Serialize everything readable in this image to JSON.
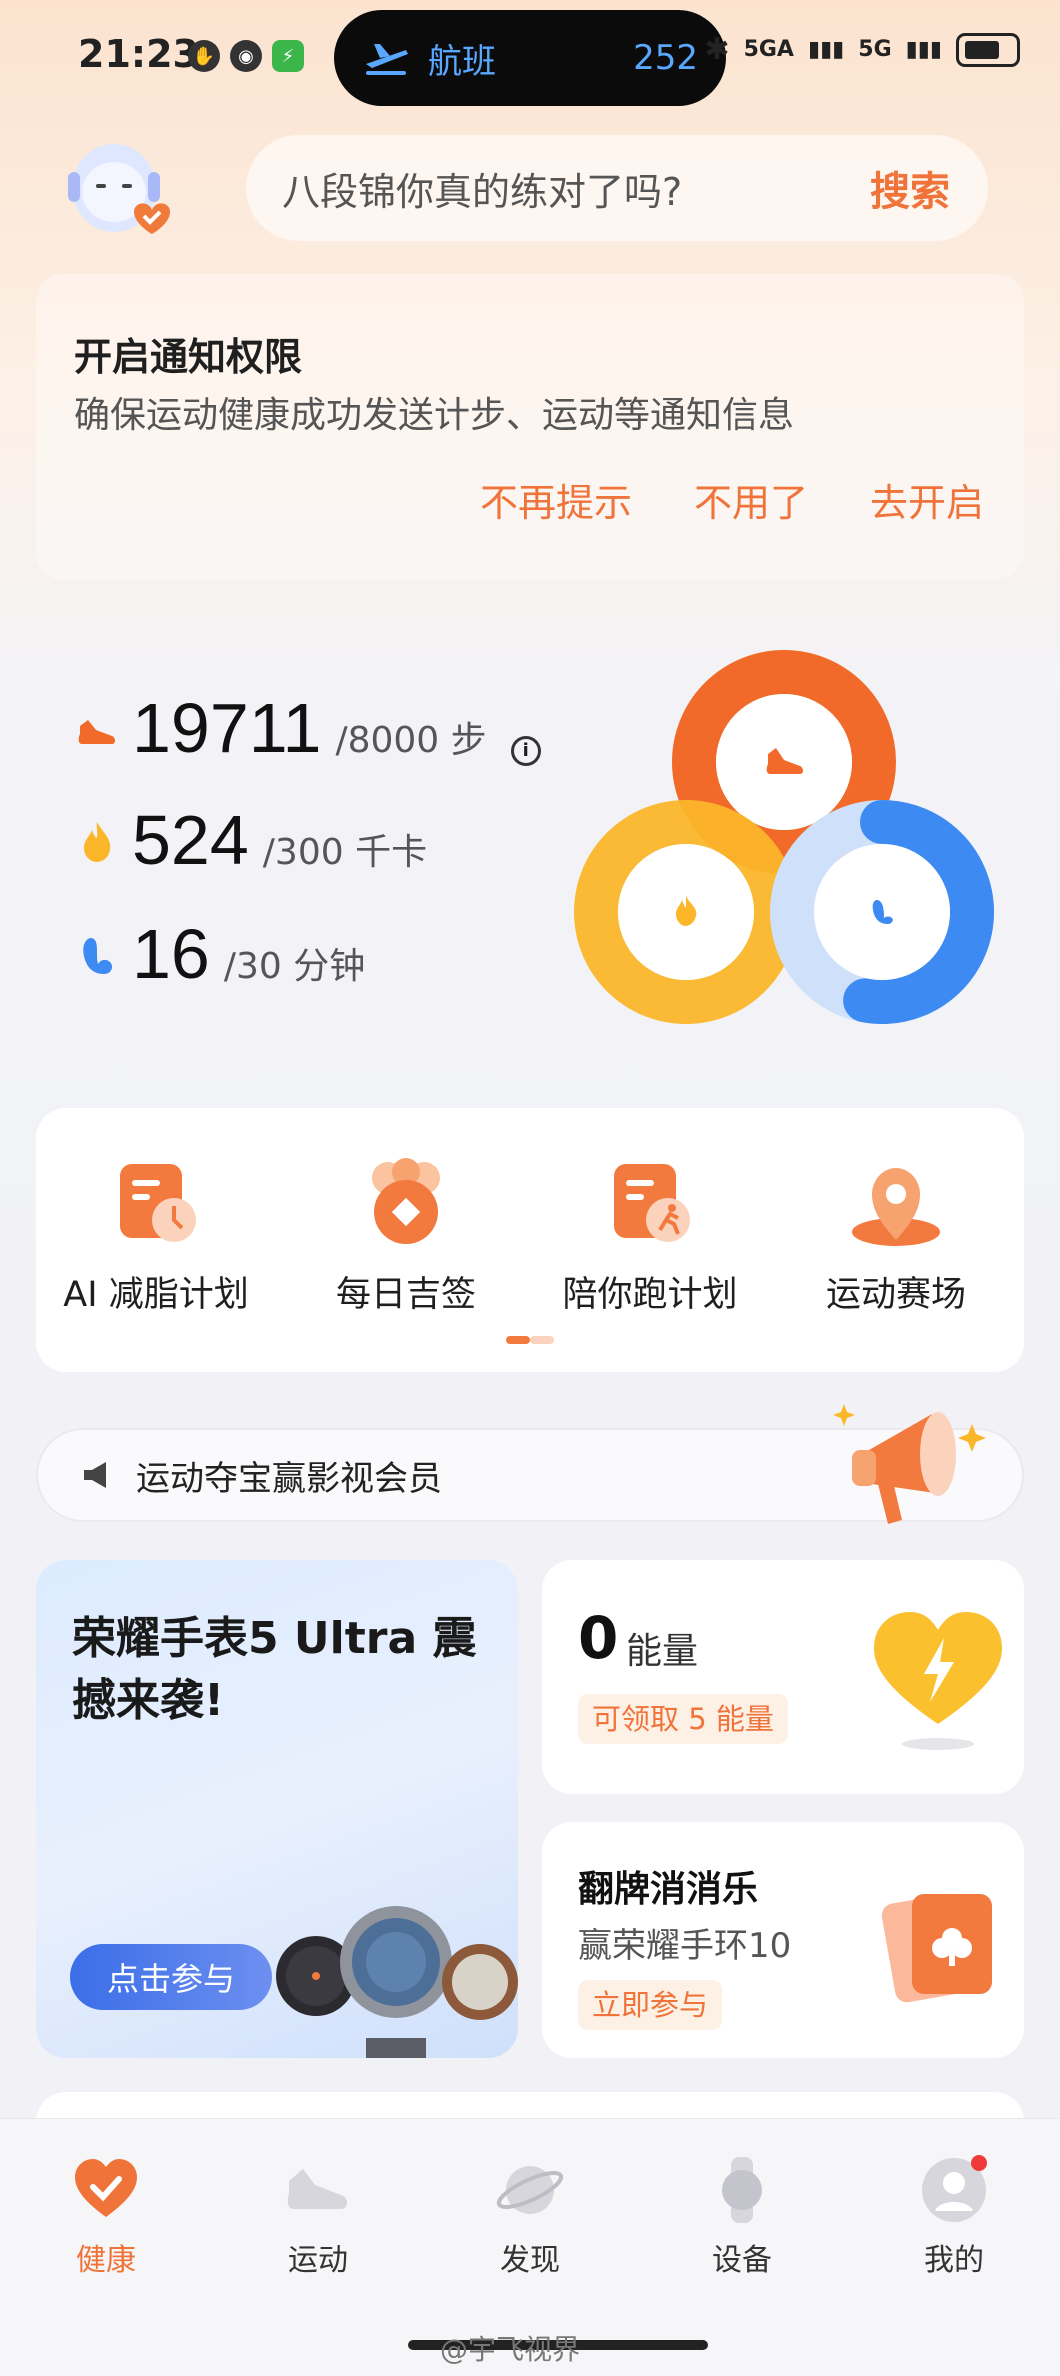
{
  "status_bar": {
    "time": "21:23",
    "pill_label": "航班",
    "pill_value": "252",
    "signal_1": "5GA",
    "signal_2": "5G"
  },
  "search": {
    "placeholder": "八段锦你真的练对了吗?",
    "button": "搜索"
  },
  "notice": {
    "title": "开启通知权限",
    "description": "确保运动健康成功发送计步、运动等通知信息",
    "actions": [
      "不再提示",
      "不用了",
      "去开启"
    ]
  },
  "stats": {
    "steps": {
      "value": "19711",
      "goal": "/8000 步",
      "icon": "shoe-icon",
      "progress": 1.0
    },
    "calories": {
      "value": "524",
      "goal": "/300 千卡",
      "icon": "flame-icon",
      "progress": 1.0
    },
    "minutes": {
      "value": "16",
      "goal": "/30 分钟",
      "icon": "muscle-icon",
      "progress": 0.53
    }
  },
  "features": [
    {
      "label": "AI 减脂计划",
      "icon": "ai-plan-icon"
    },
    {
      "label": "每日吉签",
      "icon": "daily-fortune-icon"
    },
    {
      "label": "陪你跑计划",
      "icon": "run-plan-icon"
    },
    {
      "label": "运动赛场",
      "icon": "arena-icon"
    }
  ],
  "banner": {
    "text": "运动夺宝赢影视会员"
  },
  "promo": {
    "title": "荣耀手表5 Ultra 震撼来袭!",
    "button": "点击参与"
  },
  "energy": {
    "value": "0",
    "unit": "能量",
    "badge": "可领取 5 能量"
  },
  "game": {
    "title": "翻牌消消乐",
    "subtitle": "赢荣耀手环10",
    "badge": "立即参与"
  },
  "tabs": [
    {
      "label": "健康",
      "icon": "heart-tab-icon",
      "active": true
    },
    {
      "label": "运动",
      "icon": "sneaker-tab-icon",
      "active": false
    },
    {
      "label": "发现",
      "icon": "planet-tab-icon",
      "active": false
    },
    {
      "label": "设备",
      "icon": "watch-tab-icon",
      "active": false
    },
    {
      "label": "我的",
      "icon": "profile-tab-icon",
      "active": false
    }
  ],
  "watermark": "@宇飞视界",
  "colors": {
    "accent": "#f0733a",
    "steps_ring": "#f26a2a",
    "calories_ring": "#fbb62a",
    "minutes_ring": "#3c8af2"
  }
}
